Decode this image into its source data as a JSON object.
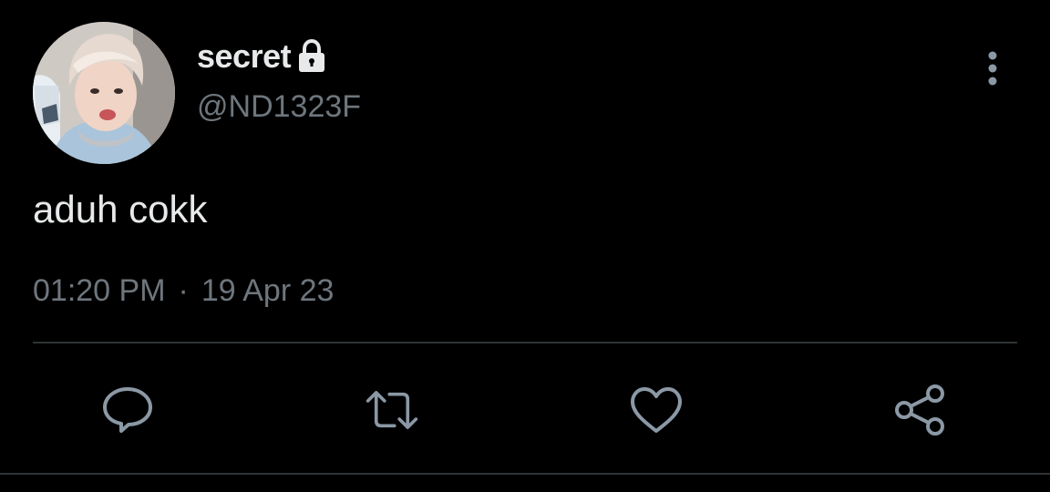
{
  "tweet": {
    "author": {
      "display_name": "secret",
      "handle": "@ND1323F",
      "protected_icon": "lock-icon"
    },
    "text": "aduh cokk",
    "time": "01:20 PM",
    "separator": "·",
    "date": "19 Apr 23"
  },
  "actions": {
    "reply_icon": "reply-icon",
    "retweet_icon": "retweet-icon",
    "like_icon": "heart-icon",
    "share_icon": "share-icon",
    "more_icon": "more-vertical-icon"
  },
  "colors": {
    "background": "#000000",
    "primary_text": "#e7e9ea",
    "secondary_text": "#6e767d",
    "icon": "#8b98a5",
    "divider": "#2f3336"
  }
}
